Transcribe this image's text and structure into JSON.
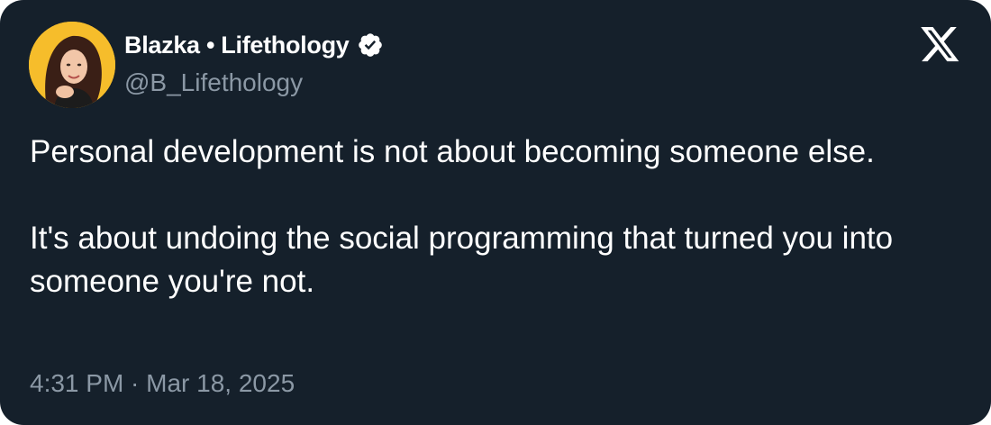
{
  "author": {
    "display_name": "Blazka • Lifethology",
    "handle": "@B_Lifethology",
    "verified": true,
    "avatar_icon": "profile-photo",
    "avatar_background": "#f6bd2b"
  },
  "brand": {
    "logo_icon": "x-logo-icon",
    "color": "#ffffff"
  },
  "tweet": {
    "paragraphs": [
      "Personal development is not about becoming someone else.",
      "It's about undoing the social programming that turned you into someone you're not."
    ]
  },
  "meta": {
    "timestamp": "4:31 PM · Mar 18, 2025"
  },
  "colors": {
    "card_background": "#15202b",
    "primary_text": "#ffffff",
    "secondary_text": "#8b98a5",
    "verified_badge": "#ffffff"
  }
}
